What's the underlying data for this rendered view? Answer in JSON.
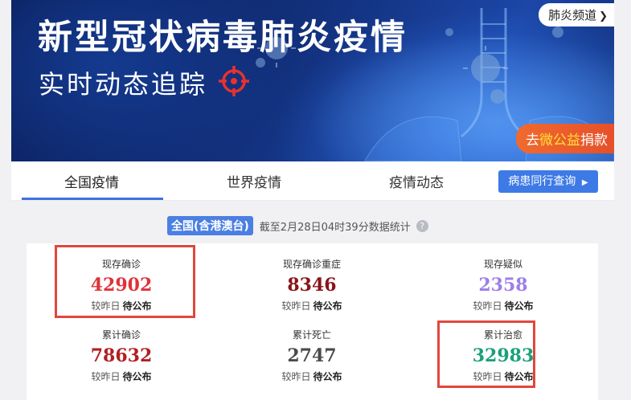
{
  "banner": {
    "title": "新型冠状病毒肺炎疫情",
    "subtitle": "实时动态追踪",
    "channel_link": "肺炎频道",
    "donate": {
      "prefix": "去",
      "highlight": "微公益",
      "suffix": "捐款"
    }
  },
  "tabs": [
    {
      "label": "全国疫情",
      "active": true
    },
    {
      "label": "世界疫情",
      "active": false
    },
    {
      "label": "疫情动态",
      "active": false
    }
  ],
  "query_button": "病患同行查询",
  "region_badge": "全国(含港澳台)",
  "update_text": "截至2月28日04时39分数据统计",
  "stats": [
    {
      "label": "现存确诊",
      "value": "42902",
      "delta_label": "较昨日",
      "delta_value": "待公布",
      "color": "#e0323a"
    },
    {
      "label": "现存确诊重症",
      "value": "8346",
      "delta_label": "较昨日",
      "delta_value": "待公布",
      "color": "#8a1418"
    },
    {
      "label": "现存疑似",
      "value": "2358",
      "delta_label": "较昨日",
      "delta_value": "待公布",
      "color": "#9d7ee8"
    },
    {
      "label": "累计确诊",
      "value": "78632",
      "delta_label": "较昨日",
      "delta_value": "待公布",
      "color": "#b21e22"
    },
    {
      "label": "累计死亡",
      "value": "2747",
      "delta_label": "较昨日",
      "delta_value": "待公布",
      "color": "#4a4a4a"
    },
    {
      "label": "累计治愈",
      "value": "32983",
      "delta_label": "较昨日",
      "delta_value": "待公布",
      "color": "#1aa07a"
    }
  ],
  "colors": {
    "accent": "#3a73e0",
    "highlight_box": "#e0473b"
  }
}
